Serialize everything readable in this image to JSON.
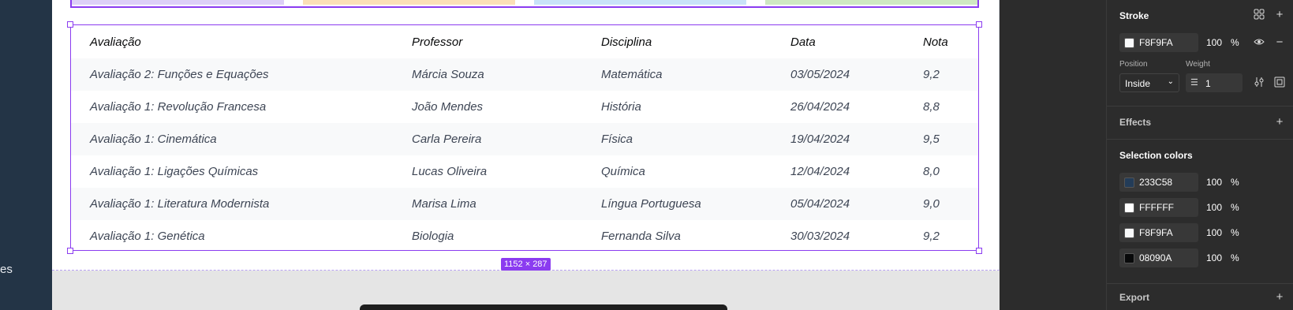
{
  "left_panel": {
    "fragment": "es"
  },
  "canvas": {
    "dimension_badge": "1152 × 287",
    "table": {
      "headers": [
        "Avaliação",
        "Professor",
        "Disciplina",
        "Data",
        "Nota"
      ],
      "rows": [
        [
          "Avaliação 2: Funções e Equações",
          "Márcia Souza",
          "Matemática",
          "03/05/2024",
          "9,2"
        ],
        [
          "Avaliação 1: Revolução Francesa",
          "João Mendes",
          "História",
          "26/04/2024",
          "8,8"
        ],
        [
          "Avaliação 1: Cinemática",
          "Carla Pereira",
          "Física",
          "19/04/2024",
          "9,5"
        ],
        [
          "Avaliação 1: Ligações Químicas",
          "Lucas Oliveira",
          "Química",
          "12/04/2024",
          "8,0"
        ],
        [
          "Avaliação 1: Literatura Modernista",
          "Marisa Lima",
          "Língua Portuguesa",
          "05/04/2024",
          "9,0"
        ],
        [
          "Avaliação 1: Genética",
          "Biologia",
          "Fernanda Silva",
          "30/03/2024",
          "9,2"
        ]
      ]
    }
  },
  "properties": {
    "stroke": {
      "title": "Stroke",
      "color": "F8F9FA",
      "opacity": "100",
      "pct": "%",
      "position_label": "Position",
      "position_value": "Inside",
      "weight_label": "Weight",
      "weight_value": "1"
    },
    "effects": {
      "title": "Effects"
    },
    "selection_colors": {
      "title": "Selection colors",
      "items": [
        {
          "hex": "233C58",
          "opacity": "100",
          "pct": "%",
          "swatch": "#233c58"
        },
        {
          "hex": "FFFFFF",
          "opacity": "100",
          "pct": "%",
          "swatch": "#ffffff"
        },
        {
          "hex": "F8F9FA",
          "opacity": "100",
          "pct": "%",
          "swatch": "#f8f9fa"
        },
        {
          "hex": "08090A",
          "opacity": "100",
          "pct": "%",
          "swatch": "#08090a"
        }
      ]
    },
    "export": {
      "title": "Export"
    }
  },
  "icons": {
    "grid": "grid-icon",
    "plus": "plus-icon",
    "eye": "eye-icon",
    "minus": "minus-icon",
    "chevron": "chevron-down-icon",
    "weight": "stroke-weight-icon",
    "adjust": "stroke-settings-icon",
    "frame": "stroke-frame-icon"
  }
}
